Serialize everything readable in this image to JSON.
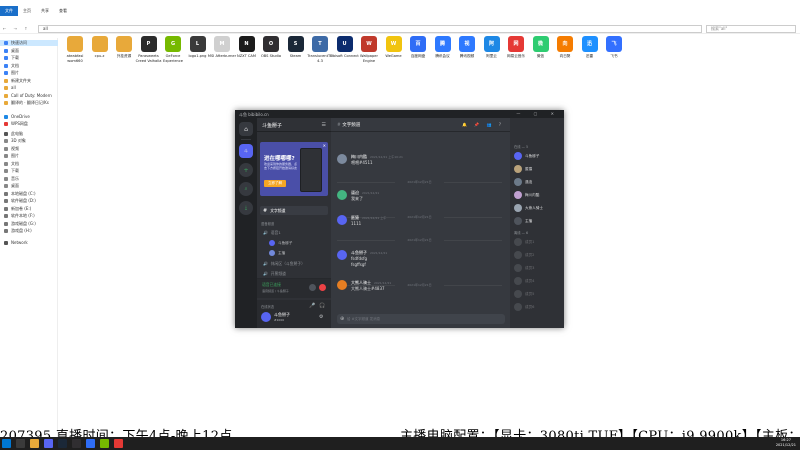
{
  "explorer": {
    "ribbon_tabs": [
      "文件",
      "主页",
      "共享",
      "查看"
    ],
    "address": "all",
    "search_placeholder": "搜索\"all\"",
    "sidebar": [
      "快速访问",
      "桌面",
      "下载",
      "文档",
      "图片",
      "新建文件夹",
      "all",
      "Call of Duty: Modern",
      "翻译的 · 翻译日记/Ks",
      "OneDrive",
      "WPS网盘",
      "此电脑",
      "3D 对象",
      "视频",
      "图片",
      "文档",
      "下载",
      "音乐",
      "桌面",
      "本地磁盘 (C:)",
      "软件磁盘 (D:)",
      "新加卷 (E:)",
      "软件本地 (F:)",
      "游戏磁盘 (G:)",
      "游戏盘 (H:)",
      "Network"
    ],
    "desktop_icons": [
      {
        "label": "ateabfasl wom660",
        "color": "#e8a93a",
        "glyph": ""
      },
      {
        "label": "cpu-z",
        "color": "#e8a93a",
        "glyph": ""
      },
      {
        "label": "外挂资源",
        "color": "#e8a93a",
        "glyph": ""
      },
      {
        "label": "Parasweets Creed Valhalla",
        "color": "#2b2b2b",
        "glyph": "P"
      },
      {
        "label": "GeForce Experience",
        "color": "#76b900",
        "glyph": "G"
      },
      {
        "label": "logo1.png",
        "color": "#3a3a3a",
        "glyph": "L"
      },
      {
        "label": "MSI Afterburner",
        "color": "#d0d0d0",
        "glyph": "M"
      },
      {
        "label": "NZXT CAM",
        "color": "#1b1b1b",
        "glyph": "N"
      },
      {
        "label": "OBS Studio",
        "color": "#302e31",
        "glyph": "O"
      },
      {
        "label": "Steam",
        "color": "#1b2838",
        "glyph": "S"
      },
      {
        "label": "TranslucentTB 4.3",
        "color": "#3d6aa6",
        "glyph": "T"
      },
      {
        "label": "Ubisoft Connect",
        "color": "#0c2c6e",
        "glyph": "U"
      },
      {
        "label": "Wallpaper Engine",
        "color": "#c0392b",
        "glyph": "W"
      },
      {
        "label": "WeGame",
        "color": "#f1c40f",
        "glyph": "W"
      },
      {
        "label": "百度网盘",
        "color": "#2f6df6",
        "glyph": "百"
      },
      {
        "label": "腾讯会议",
        "color": "#2e79ff",
        "glyph": "腾"
      },
      {
        "label": "腾讯视频",
        "color": "#2e79ff",
        "glyph": "视"
      },
      {
        "label": "阿里云",
        "color": "#1e88e5",
        "glyph": "阿"
      },
      {
        "label": "网易云音乐",
        "color": "#e53935",
        "glyph": "网"
      },
      {
        "label": "微信",
        "color": "#2ecc71",
        "glyph": "微"
      },
      {
        "label": "向日葵",
        "color": "#f57c00",
        "glyph": "向"
      },
      {
        "label": "迅雷",
        "color": "#1e90ff",
        "glyph": "迅"
      },
      {
        "label": "飞书",
        "color": "#3370ff",
        "glyph": "飞"
      }
    ]
  },
  "discord": {
    "title": "斗鱼 bibibilo.cn",
    "guild_name": "斗鱼掰子",
    "banner": {
      "title": "进在哪哪哪?",
      "subtitle": "欢迎来到你的服务器，点击下方按钮开始邀请好友",
      "button": "立即了解"
    },
    "channels": {
      "text_selected": "文字频道",
      "category_voice": "语音频道",
      "voice_1": "语音1",
      "users": [
        "斗鱼掰子",
        "主播"
      ],
      "voice_2": "休闲区（斗鱼掰子）",
      "voice_3": "开黑频道",
      "voice_status": "语音已连接",
      "voice_status_sub": "语音频道 / 斗鱼掰子"
    },
    "user": {
      "name": "斗鱼掰子",
      "tag": "#1000"
    },
    "chat": {
      "channel": "文字频道",
      "messages": [
        {
          "author": "梅川内酷",
          "time": "2021/12/21 上午10:21",
          "lines": [
            "喂喂#4511"
          ]
        },
        {
          "author": "逼迫",
          "time": "2021/12/21",
          "lines": [
            "我来了"
          ]
        },
        {
          "author": "匿猿",
          "time": "2021/12/21 上午",
          "lines": [
            "1111"
          ]
        },
        {
          "author": "斗鱼掰子",
          "time": "2021/12/21",
          "lines": [
            "fsdfdsfg",
            "fsgffsgf"
          ]
        },
        {
          "author": "大熊人骑士",
          "time": "2021/12/21",
          "lines": [
            "大熊人骑士#4837"
          ]
        }
      ],
      "dividers": [
        "2021年12月21日",
        "2021年12月21日",
        "2021年12月21日",
        "2021年12月21日"
      ],
      "input_placeholder": "给 #文字频道 发消息"
    },
    "members": {
      "online_head": "在线 — 5",
      "online": [
        "斗鱼掰子",
        "匿猿",
        "逼迫",
        "梅川内酷",
        "大熊人骑士",
        "主播"
      ],
      "offline_head": "离线 — 6",
      "offline": [
        "成员1",
        "成员2",
        "成员3",
        "成员4",
        "成员5",
        "成员6"
      ]
    }
  },
  "overlay": {
    "left": "207395  直播时间：下午4点-晚上12点",
    "right": "主播电脑配置：【显卡：3080ti TUF】【CPU：i9 9900k】【主板："
  },
  "taskbar": {
    "clock_time": "16:27",
    "clock_date": "2021/12/21"
  }
}
